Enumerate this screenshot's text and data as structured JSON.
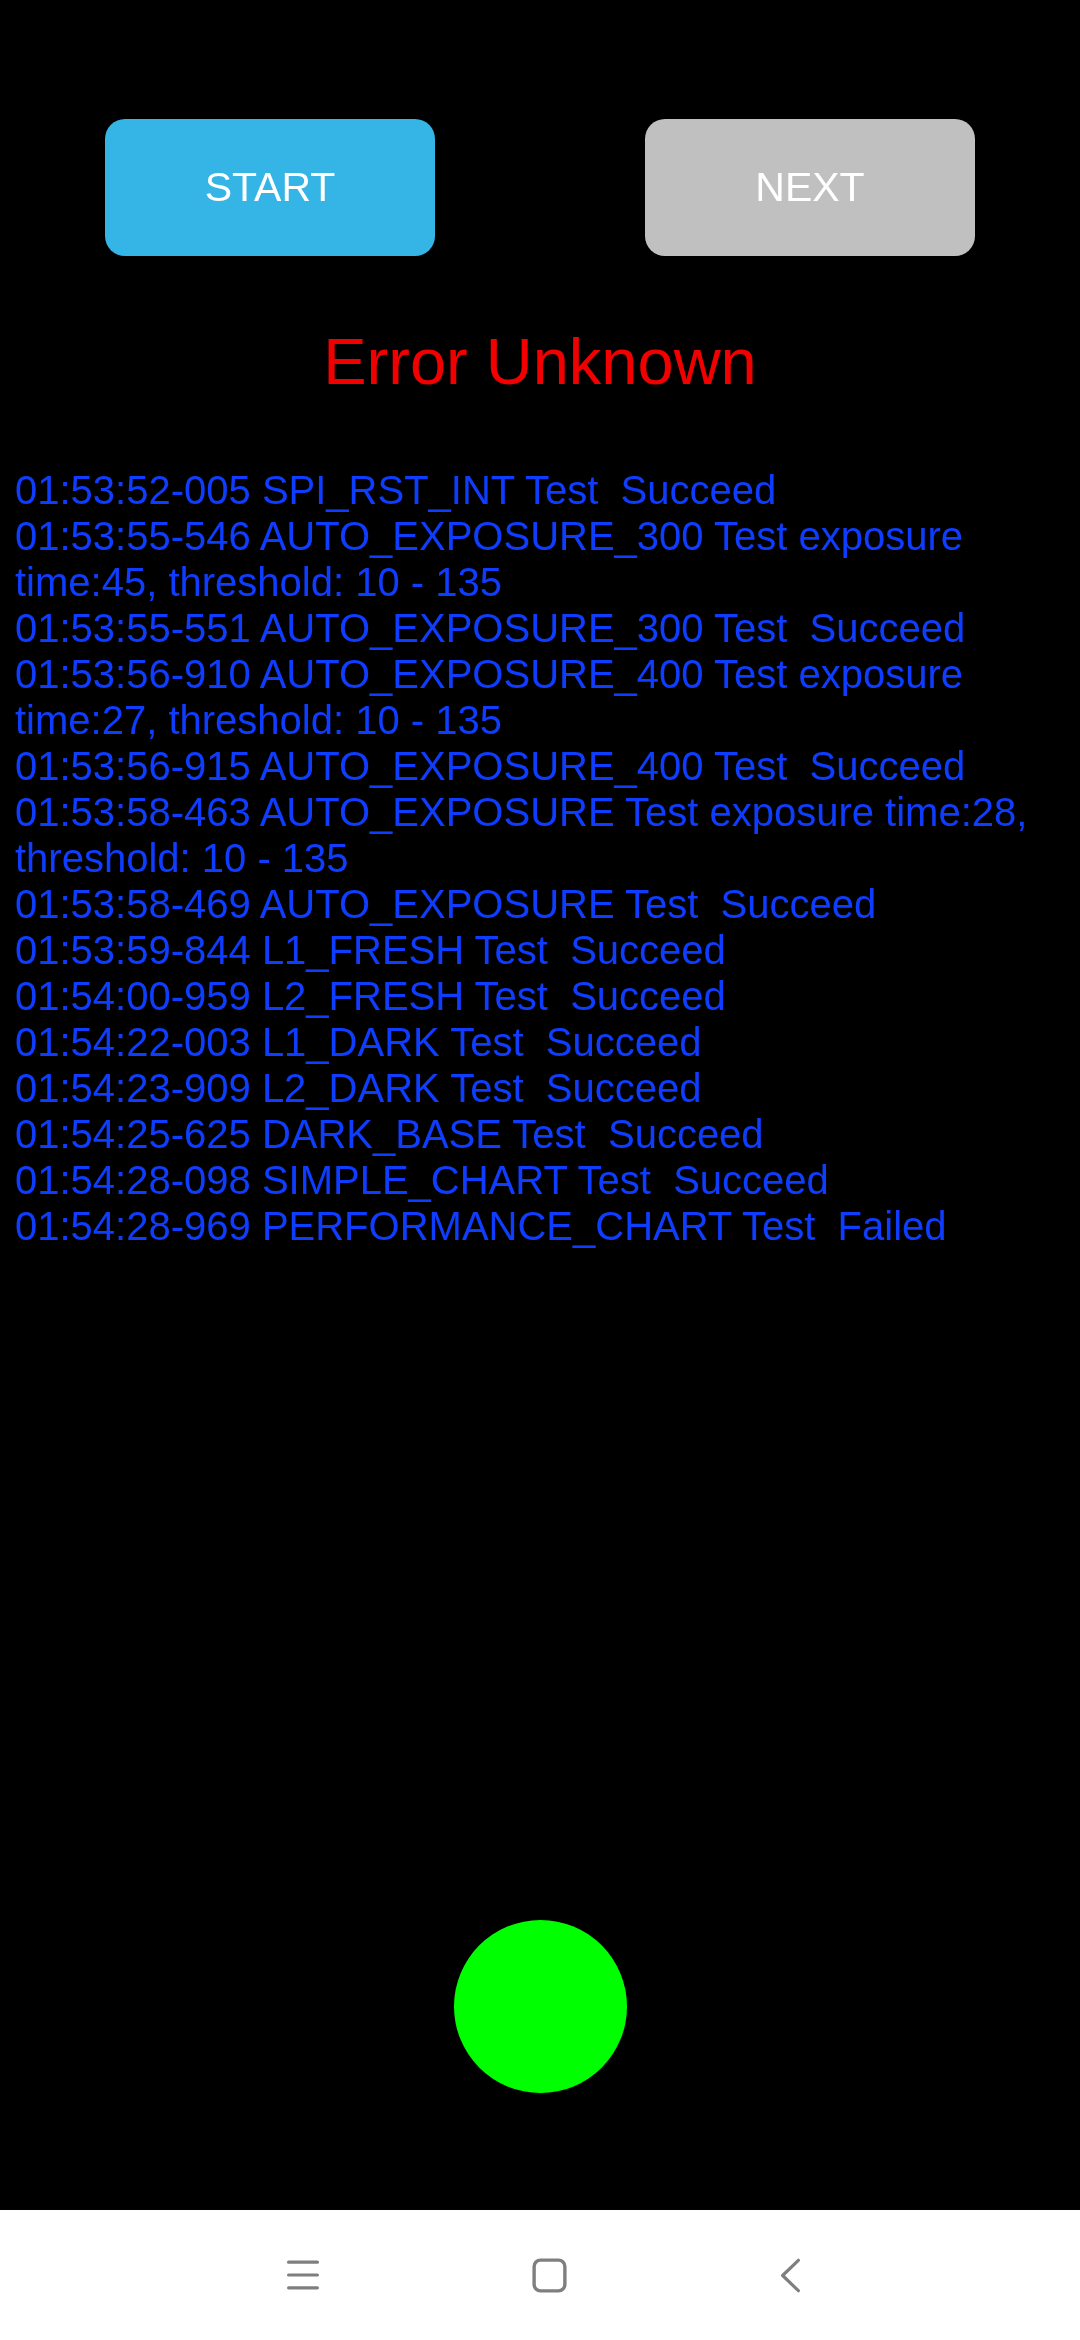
{
  "buttons": [
    {
      "label": "START",
      "disabled": false
    },
    {
      "label": "NEXT",
      "disabled": true
    }
  ],
  "status": {
    "text": "Error Unknown"
  },
  "log": {
    "entries": [
      "01:53:52-005 SPI_RST_INT Test  Succeed",
      "01:53:55-546 AUTO_EXPOSURE_300 Test exposure time:45, threshold: 10 - 135",
      "01:53:55-551 AUTO_EXPOSURE_300 Test  Succeed",
      "01:53:56-910 AUTO_EXPOSURE_400 Test exposure time:27, threshold: 10 - 135",
      "01:53:56-915 AUTO_EXPOSURE_400 Test  Succeed",
      "01:53:58-463 AUTO_EXPOSURE Test exposure time:28, threshold: 10 - 135",
      "01:53:58-469 AUTO_EXPOSURE Test  Succeed",
      "01:53:59-844 L1_FRESH Test  Succeed",
      "01:54:00-959 L2_FRESH Test  Succeed",
      "01:54:22-003 L1_DARK Test  Succeed",
      "01:54:23-909 L2_DARK Test  Succeed",
      "01:54:25-625 DARK_BASE Test  Succeed",
      "01:54:28-098 SIMPLE_CHART Test  Succeed",
      "01:54:28-969 PERFORMANCE_CHART Test  Failed"
    ]
  },
  "indicator": {
    "color": "#00ff00"
  }
}
